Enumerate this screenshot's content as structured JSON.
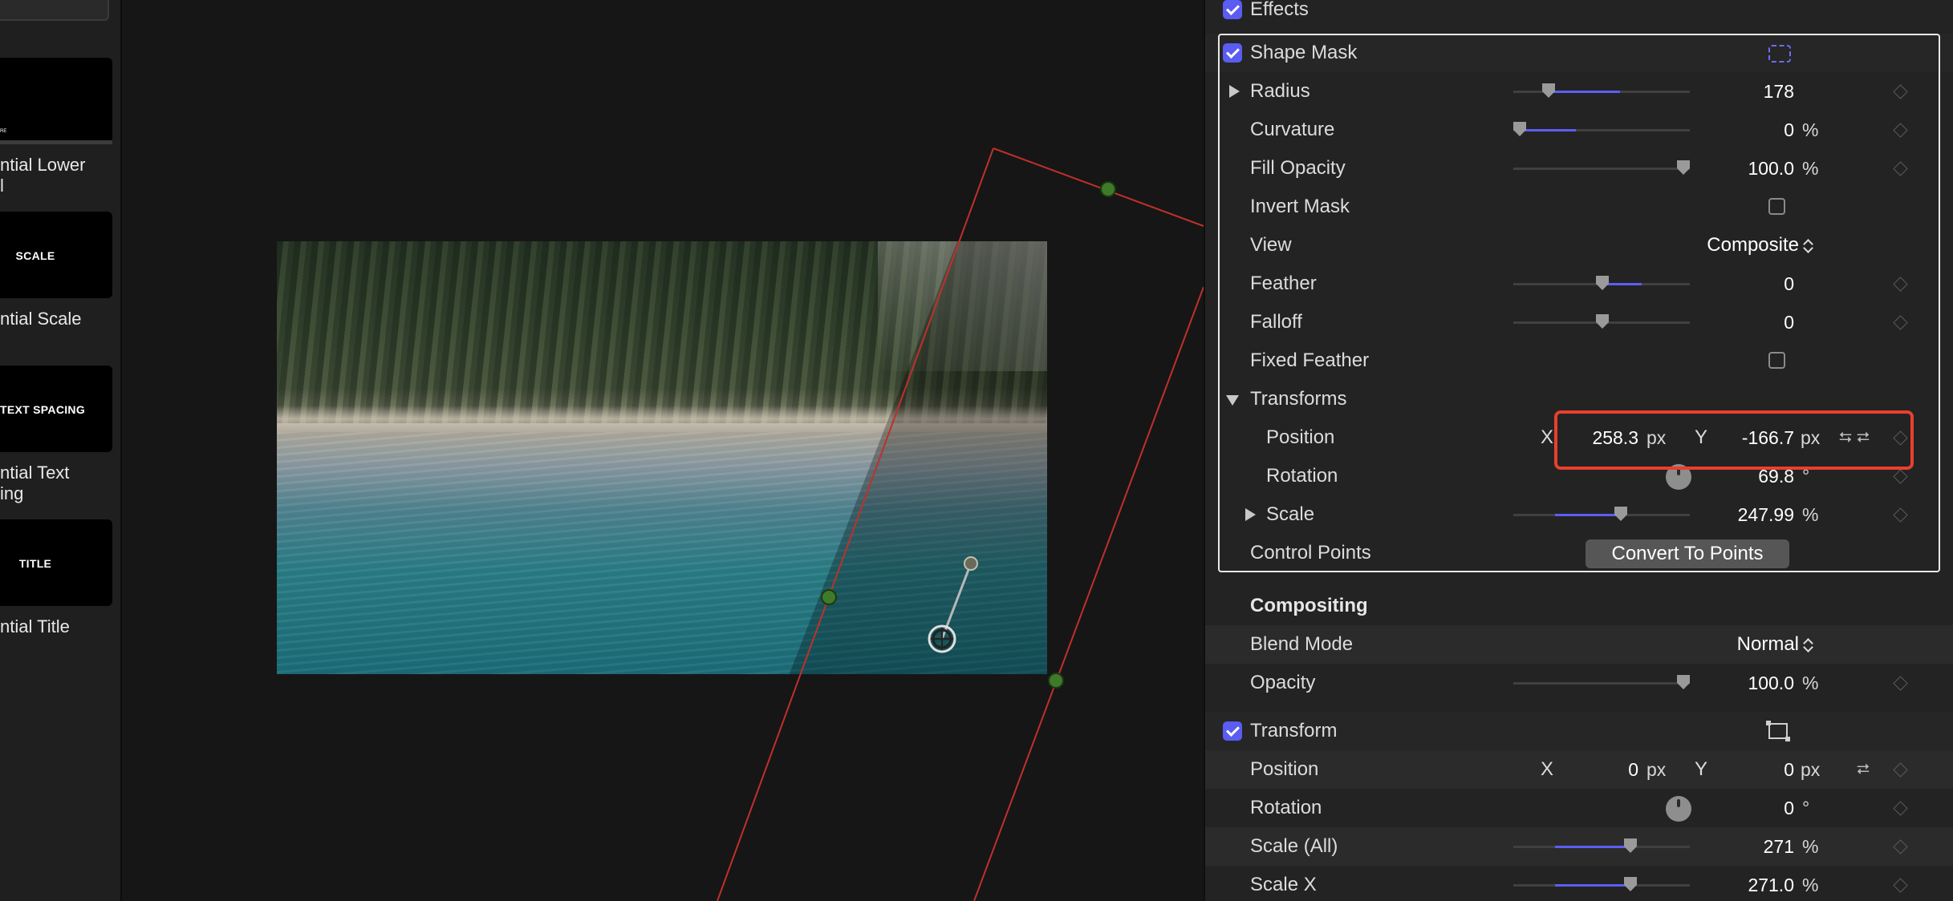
{
  "browser": {
    "items": [
      {
        "thumb_text": "",
        "small_text": "RE",
        "label": "ntial Lower",
        "label2": "l"
      },
      {
        "thumb_text": "SCALE",
        "small_text": "",
        "label": "ntial Scale",
        "label2": ""
      },
      {
        "thumb_text": "TEXT SPACING",
        "small_text": "",
        "label": "ntial Text",
        "label2": "ing"
      },
      {
        "thumb_text": "TITLE",
        "small_text": "",
        "label": "ntial Title",
        "label2": ""
      }
    ]
  },
  "inspector": {
    "effects_header": "Effects",
    "shape_mask": {
      "title": "Shape Mask",
      "radius": {
        "label": "Radius",
        "value": "178",
        "level": 0.6
      },
      "curvature": {
        "label": "Curvature",
        "value": "0",
        "unit": "%",
        "level": 0.0
      },
      "fill_opacity": {
        "label": "Fill Opacity",
        "value": "100.0",
        "unit": "%",
        "level": 1.0
      },
      "invert_mask": {
        "label": "Invert Mask",
        "checked": false
      },
      "view": {
        "label": "View",
        "value": "Composite"
      },
      "feather": {
        "label": "Feather",
        "value": "0",
        "level": 0.5
      },
      "falloff": {
        "label": "Falloff",
        "value": "0",
        "level": 0.5
      },
      "fixed_feather": {
        "label": "Fixed Feather",
        "checked": false
      },
      "transforms": {
        "label": "Transforms",
        "position": {
          "label": "Position",
          "x_label": "X",
          "x": "258.3",
          "x_unit": "px",
          "y_label": "Y",
          "y": "-166.7",
          "y_unit": "px"
        },
        "rotation": {
          "label": "Rotation",
          "value": "69.8",
          "unit": "°"
        },
        "scale": {
          "label": "Scale",
          "value": "247.99",
          "unit": "%",
          "level": 0.6
        }
      },
      "control_points": {
        "label": "Control Points",
        "button": "Convert To Points"
      }
    },
    "compositing": {
      "title": "Compositing",
      "blend_mode": {
        "label": "Blend Mode",
        "value": "Normal"
      },
      "opacity": {
        "label": "Opacity",
        "value": "100.0",
        "unit": "%",
        "level": 1.0
      }
    },
    "transform": {
      "title": "Transform",
      "position": {
        "label": "Position",
        "x_label": "X",
        "x": "0",
        "x_unit": "px",
        "y_label": "Y",
        "y": "0",
        "y_unit": "px"
      },
      "rotation": {
        "label": "Rotation",
        "value": "0",
        "unit": "°"
      },
      "scale_all": {
        "label": "Scale (All)",
        "value": "271",
        "unit": "%",
        "level": 0.65
      },
      "scale_x": {
        "label": "Scale X",
        "value": "271.0",
        "unit": "%",
        "level": 0.65
      }
    }
  },
  "colors": {
    "accent": "#5a5cf2",
    "highlight": "#e8402e",
    "mask_line": "#c0302a",
    "handle": "#3e7a2a"
  }
}
